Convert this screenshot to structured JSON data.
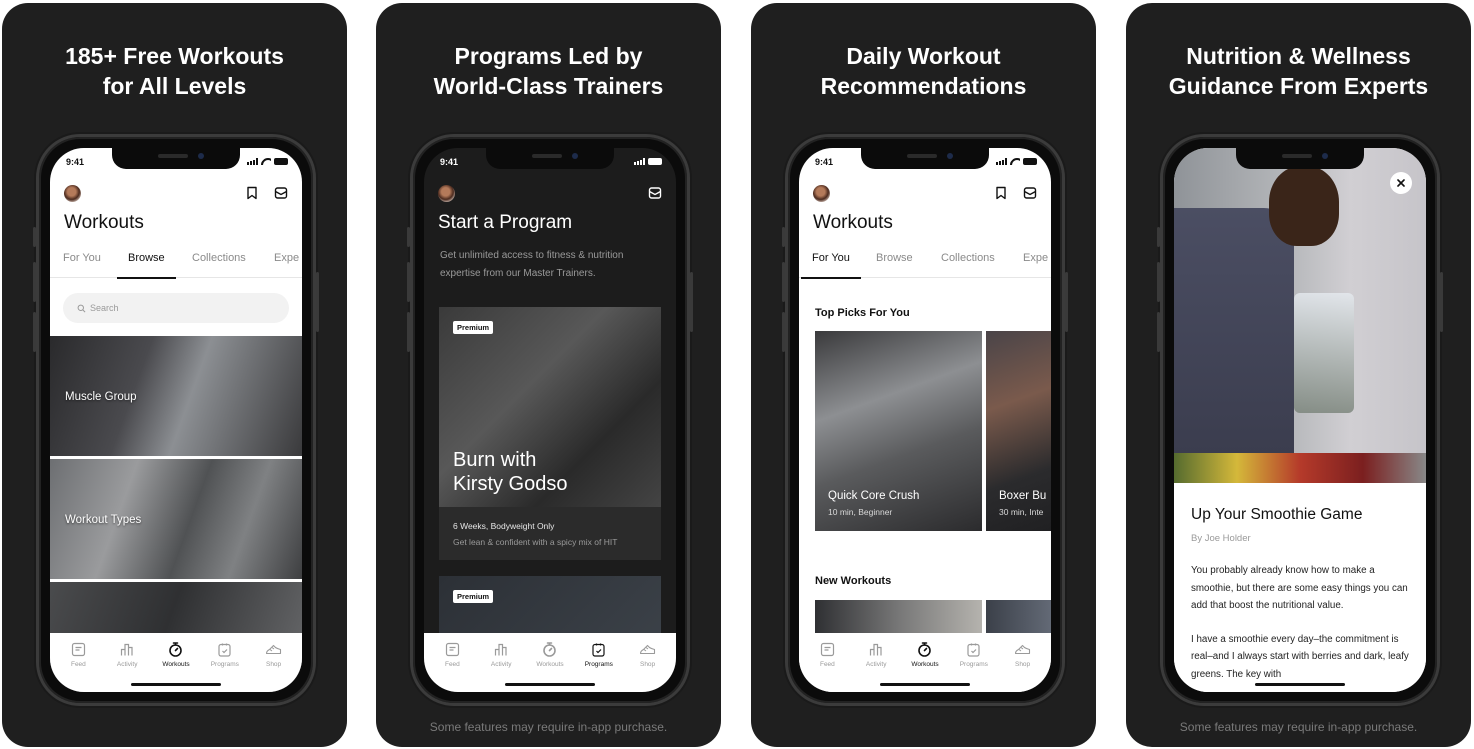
{
  "panels": [
    {
      "headline": "185+ Free Workouts\nfor All Levels",
      "screen": {
        "time": "9:41",
        "title": "Workouts",
        "tabs": [
          "For You",
          "Browse",
          "Collections",
          "Expe"
        ],
        "active_tab": "Browse",
        "search_placeholder": "Search",
        "categories": [
          "Muscle Group",
          "Workout Types",
          ""
        ]
      }
    },
    {
      "headline": "Programs Led by\nWorld-Class Trainers",
      "footnote": "Some features may require in-app purchase.",
      "screen": {
        "time": "9:41",
        "title": "Start a Program",
        "intro": "Get unlimited access to fitness & nutrition expertise from our Master Trainers.",
        "programs": [
          {
            "badge": "Premium",
            "name": "Burn with\nKirsty Godso",
            "meta": "6 Weeks, Bodyweight Only",
            "description": "Get lean & confident with a spicy mix of HIT"
          },
          {
            "badge": "Premium"
          }
        ]
      }
    },
    {
      "headline": "Daily Workout\nRecommendations",
      "screen": {
        "time": "9:41",
        "title": "Workouts",
        "tabs": [
          "For You",
          "Browse",
          "Collections",
          "Expe"
        ],
        "active_tab": "For You",
        "top_picks_title": "Top Picks For You",
        "top_picks": [
          {
            "name": "Quick Core Crush",
            "meta": "10 min, Beginner"
          },
          {
            "name": "Boxer Bu",
            "meta": "30 min, Inte"
          }
        ],
        "new_workouts_title": "New Workouts"
      }
    },
    {
      "headline": "Nutrition & Wellness\nGuidance From Experts",
      "footnote": "Some features may require in-app purchase.",
      "screen": {
        "article_title": "Up Your Smoothie Game",
        "author": "By Joe Holder",
        "paragraphs": [
          "You probably already know how to make a smoothie, but there are some easy things you can add that boost the nutritional value.",
          "I have a smoothie every day–the commitment is real–and I always start with berries and dark, leafy greens. The key with"
        ]
      }
    }
  ],
  "tabbar": {
    "items": [
      {
        "label": "Feed",
        "icon": "feed-icon"
      },
      {
        "label": "Activity",
        "icon": "activity-icon"
      },
      {
        "label": "Workouts",
        "icon": "stopwatch-icon"
      },
      {
        "label": "Programs",
        "icon": "clipboard-icon"
      },
      {
        "label": "Shop",
        "icon": "shoe-icon"
      }
    ]
  },
  "colors": {
    "panel_bg": "#1f1f1f",
    "accent": "#111111",
    "inactive": "#9a9a9a"
  }
}
